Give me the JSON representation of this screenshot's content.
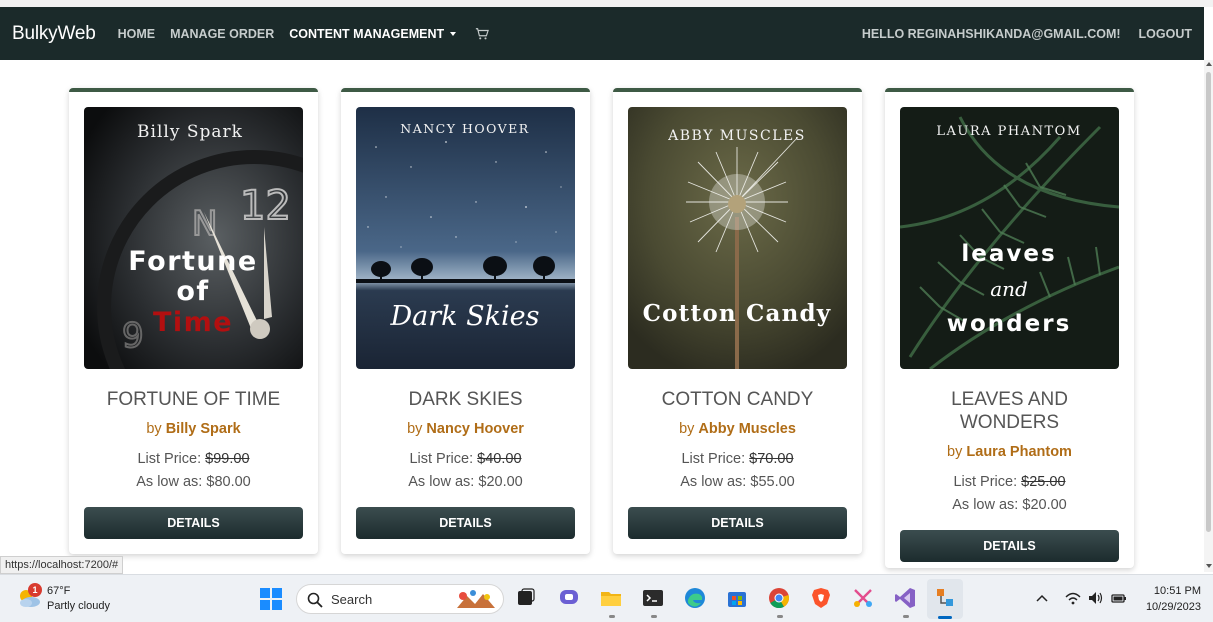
{
  "navbar": {
    "brand": "BulkyWeb",
    "links": [
      "HOME",
      "MANAGE ORDER",
      "CONTENT MANAGEMENT"
    ],
    "greeting": "HELLO REGINAHSHIKANDA@GMAIL.COM!",
    "logout": "LOGOUT",
    "colors": {
      "background": "#1b2a2a",
      "accent": "#3e5a45",
      "author": "#b06d17"
    }
  },
  "books": [
    {
      "cover_author": "Billy Spark",
      "cover_title_lines": [
        "Fortune",
        "of",
        "Time"
      ],
      "title": "FORTUNE OF TIME",
      "by": "by",
      "author": "Billy Spark",
      "list_price_label": "List Price:",
      "list_price": "$99.00",
      "low_label": "As low as:",
      "low_price": "$80.00",
      "button": "DETAILS"
    },
    {
      "cover_author": "NANCY HOOVER",
      "cover_title": "Dark Skies",
      "title": "DARK SKIES",
      "by": "by",
      "author": "Nancy Hoover",
      "list_price_label": "List Price:",
      "list_price": "$40.00",
      "low_label": "As low as:",
      "low_price": "$20.00",
      "button": "DETAILS"
    },
    {
      "cover_author": "ABBY MUSCLES",
      "cover_title": "Cotton Candy",
      "title": "COTTON CANDY",
      "by": "by",
      "author": "Abby Muscles",
      "list_price_label": "List Price:",
      "list_price": "$70.00",
      "low_label": "As low as:",
      "low_price": "$55.00",
      "button": "DETAILS"
    },
    {
      "cover_author": "LAURA PHANTOM",
      "cover_title_lines": [
        "leaves",
        "and",
        "wonders"
      ],
      "title": "LEAVES AND WONDERS",
      "by": "by",
      "author": "Laura Phantom",
      "list_price_label": "List Price:",
      "list_price": "$25.00",
      "low_label": "As low as:",
      "low_price": "$20.00",
      "button": "DETAILS"
    }
  ],
  "status_url": "https://localhost:7200/#",
  "taskbar": {
    "weather_badge": "1",
    "temperature": "67°F",
    "condition": "Partly cloudy",
    "search_placeholder": "Search",
    "time": "10:51 PM",
    "date": "10/29/2023",
    "icons": [
      "start-icon",
      "search-icon",
      "task-view-icon",
      "chat-icon",
      "file-explorer-icon",
      "terminal-icon",
      "edge-icon",
      "store-icon",
      "chrome-icon",
      "brave-icon",
      "snip-icon",
      "visual-studio-icon",
      "network-app-icon"
    ]
  }
}
